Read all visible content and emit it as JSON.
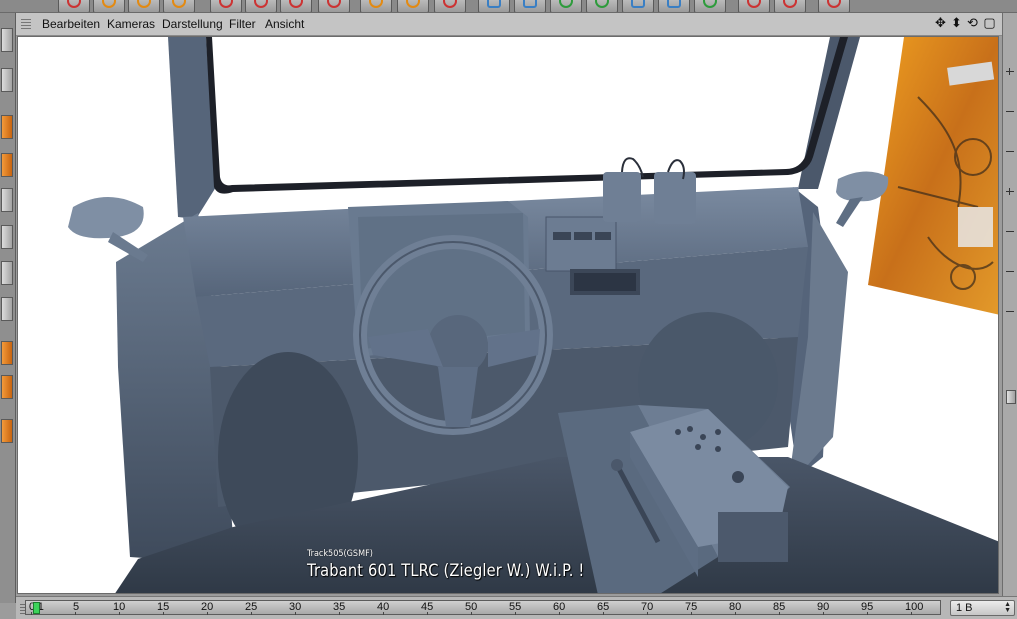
{
  "menubar": {
    "items": [
      "Bearbeiten",
      "Kameras",
      "Darstellung",
      "Filter",
      "Ansicht"
    ],
    "nav_icons": [
      "move-icon",
      "zoom-icon",
      "rotate-icon",
      "maximize-icon"
    ],
    "nav_glyphs": [
      "✥",
      "⬍",
      "⟲",
      "▢"
    ]
  },
  "viewport": {
    "overlay_small": "Track505(GSMF)",
    "overlay_main": "Trabant 601 TLRC (Ziegler W.) W.i.P. !"
  },
  "timeline": {
    "labels": [
      "0",
      "1",
      "5",
      "10",
      "15",
      "20",
      "25",
      "30",
      "35",
      "40",
      "45",
      "50",
      "55",
      "60",
      "65",
      "70",
      "75",
      "80",
      "85",
      "90",
      "95",
      "100"
    ],
    "current_frame": 1,
    "frame_field": "1 B"
  },
  "colors": {
    "viewport_bg": "#ffffff",
    "model": "#5d6d82",
    "accent": "#e38a12",
    "timeline_cursor": "#3cd35a"
  }
}
